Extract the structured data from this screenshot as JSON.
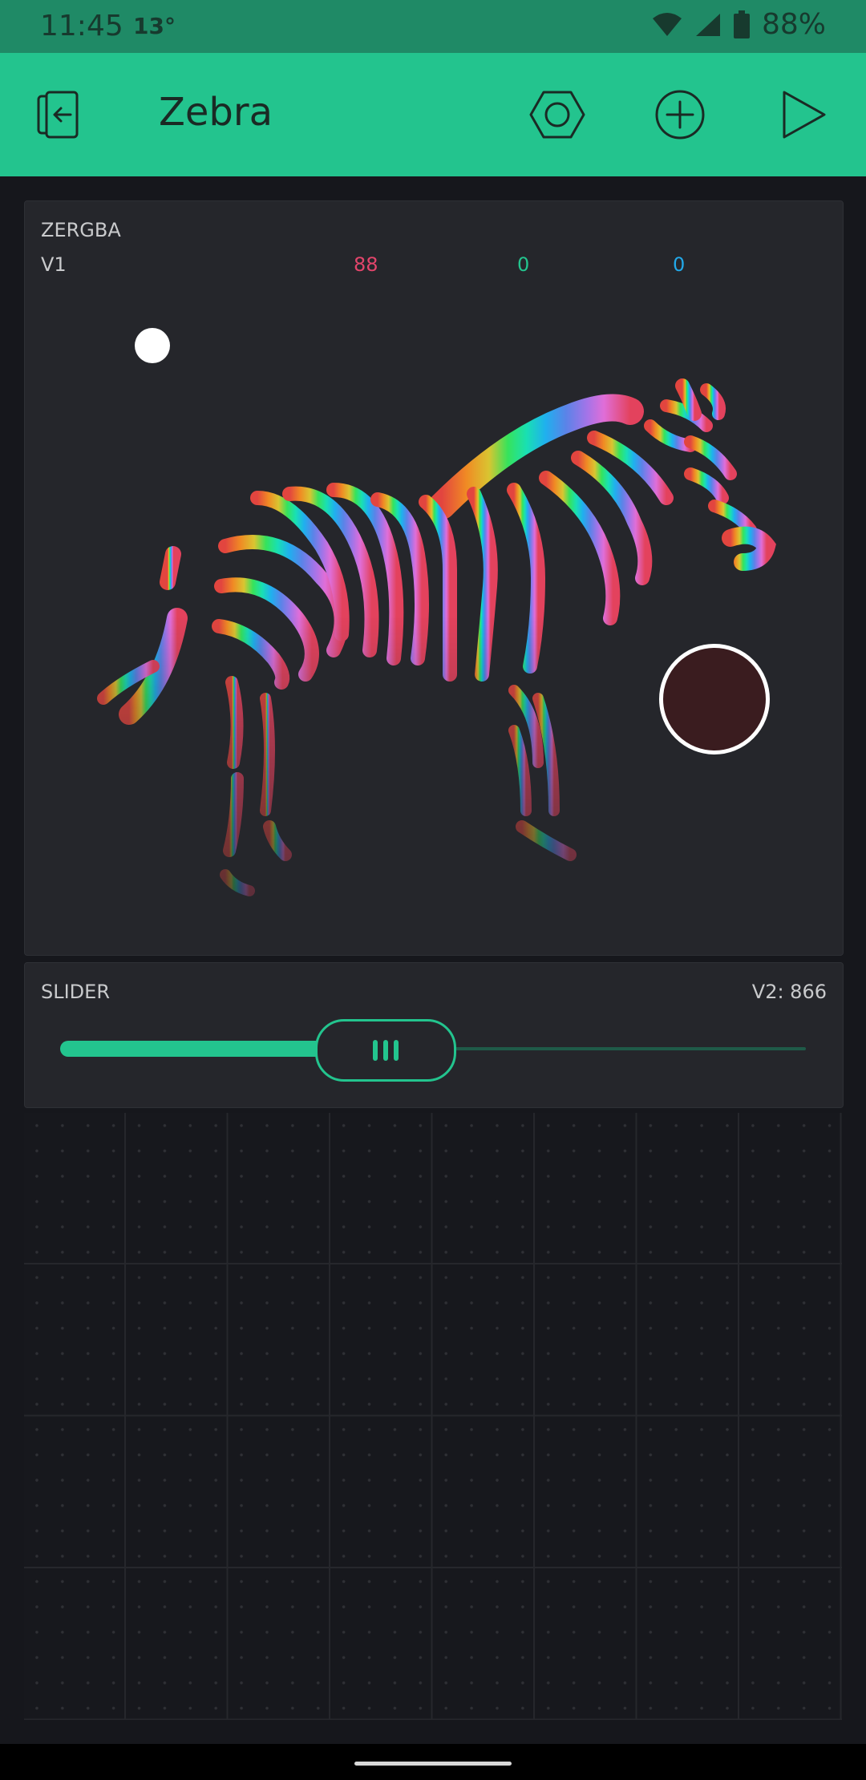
{
  "status_bar": {
    "time": "11:45",
    "temperature": "13°",
    "battery": "88%"
  },
  "header": {
    "title": "Zebra"
  },
  "zergba": {
    "name": "ZERGBA",
    "pin": "V1",
    "r": "88",
    "g": "0",
    "b": "0"
  },
  "slider": {
    "name": "SLIDER",
    "value_label": "V2: 866",
    "value": 866
  },
  "colors": {
    "accent": "#23c48e",
    "header_bg": "#23c48e",
    "status_bg": "#1f8a66",
    "widget_bg": "#25262b",
    "canvas_bg": "#16171c",
    "selected_color": "#3a1c1f",
    "r_color": "#e2456b",
    "g_color": "#23c48e",
    "b_color": "#22a8e8"
  },
  "icons": {
    "back": "exit-icon",
    "settings": "hexagon-settings-icon",
    "add": "plus-circle-icon",
    "play": "play-icon",
    "wifi": "wifi-icon",
    "signal": "signal-icon",
    "battery": "battery-icon"
  }
}
